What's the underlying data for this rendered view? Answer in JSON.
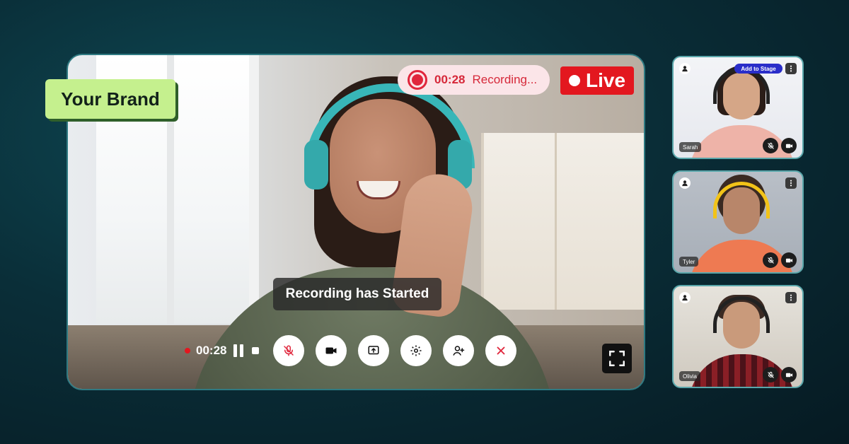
{
  "brand": {
    "label": "Your Brand"
  },
  "recording": {
    "time": "00:28",
    "label": "Recording..."
  },
  "live": {
    "label": "Live"
  },
  "toast": {
    "text": "Recording has Started"
  },
  "controls": {
    "time": "00:28",
    "buttons": [
      "mic-off-icon",
      "camera-icon",
      "screen-share-icon",
      "settings-icon",
      "add-user-icon",
      "close-icon"
    ]
  },
  "participants": [
    {
      "name": "Sarah",
      "action": "Add to Stage"
    },
    {
      "name": "Tyler"
    },
    {
      "name": "Olivia"
    }
  ],
  "colors": {
    "accent_brand": "#c5f08e",
    "live_red": "#e3171f",
    "recording_red": "#e0263c",
    "stage_button_blue": "#2a2ec9",
    "background": "#0a2e38"
  }
}
